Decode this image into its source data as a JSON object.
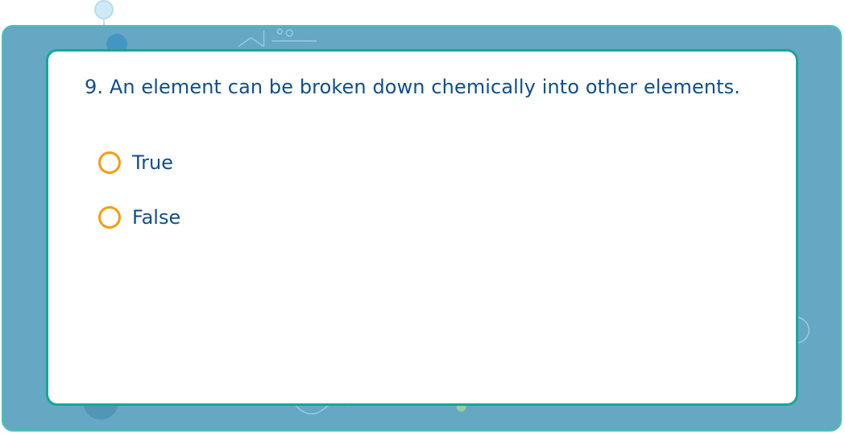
{
  "quiz": {
    "question": "9. An element can be broken down chemically into other elements.",
    "options": [
      {
        "label": "True",
        "selected": false
      },
      {
        "label": "False",
        "selected": false
      }
    ]
  },
  "colors": {
    "panel_bg": "#66a7c4",
    "panel_border": "#4cc2b6",
    "card_border": "#16a699",
    "text": "#0f4f8a",
    "radio": "#f29d12"
  },
  "icons": {
    "background_decor": "molecule-decor-icon"
  }
}
